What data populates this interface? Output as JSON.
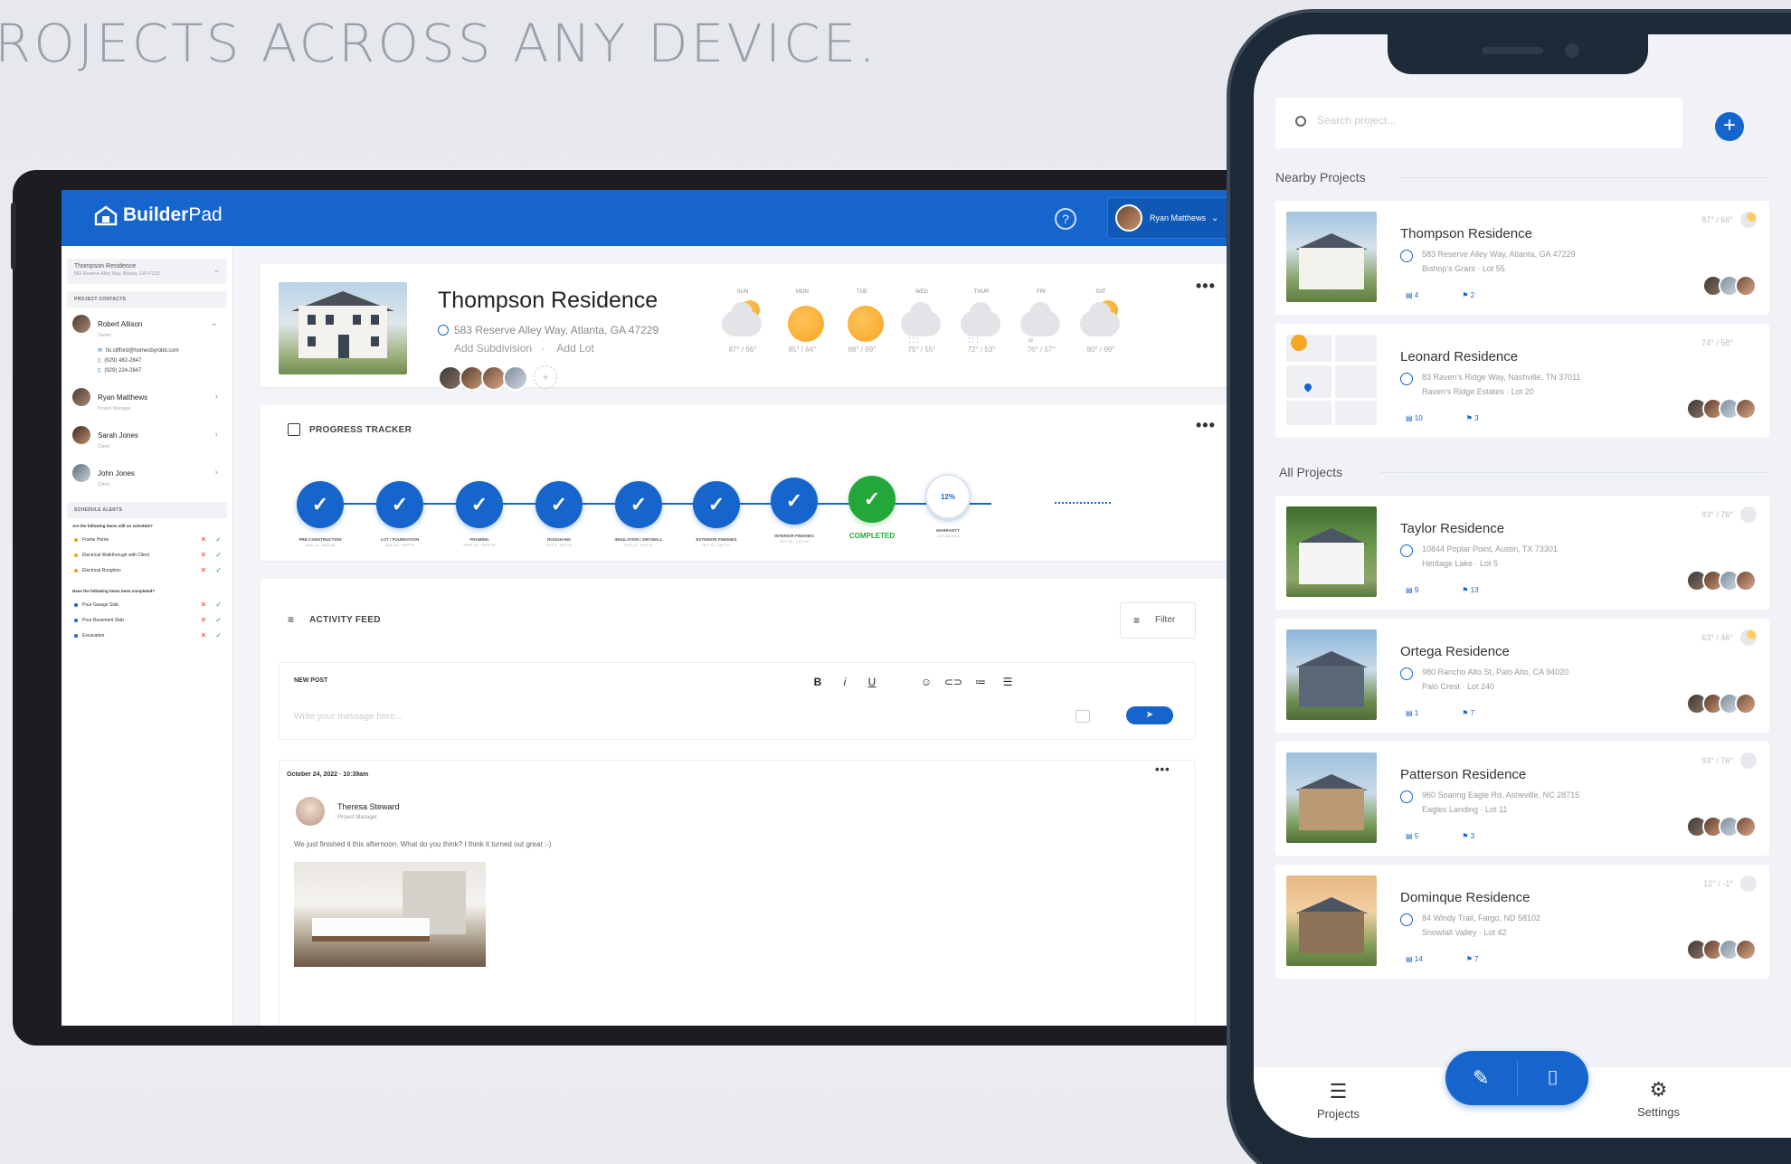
{
  "headline": "ROJECTS ACROSS ANY DEVICE.",
  "tablet": {
    "app": {
      "brand_bold": "Builder",
      "brand_light": "Pad",
      "help": "?",
      "user_name": "Ryan Matthews"
    },
    "sidebar": {
      "project_name": "Thompson Residence",
      "project_sub": "583 Reserve Alley Way, Atlanta, GA 47229",
      "contacts_header": "PROJECT CONTACTS",
      "contacts": [
        {
          "name": "Robert Allison",
          "role": "Owner"
        },
        {
          "name": "Ryan Matthews",
          "role": "Project Manager"
        },
        {
          "name": "Sarah Jones",
          "role": "Client"
        },
        {
          "name": "John Jones",
          "role": "Client"
        }
      ],
      "contact_details": [
        "fix.clifford@homesbyrobb.com",
        "(929) 482-2847",
        "(929) 224-2847"
      ],
      "alerts_header": "SCHEDULE ALERTS",
      "question1": "Are the following items still on schedule?",
      "alerts1": [
        "Frame Home",
        "Electrical Walkthrough with Client",
        "Electrical Roughins"
      ],
      "question2": "Have the following items been completed?",
      "alerts2": [
        "Pour Garage Slab",
        "Pour Basement Slab",
        "Excavation"
      ]
    },
    "project": {
      "title": "Thompson Residence",
      "address": "583 Reserve Alley Way,  Atlanta, GA 47229",
      "add_subdivision": "Add Subdivision",
      "add_lot": "Add Lot",
      "weather": [
        {
          "day": "SUN",
          "temp": "87° / 66°",
          "icon": "partly-cloudy"
        },
        {
          "day": "MON",
          "temp": "85° / 64°",
          "icon": "sunny"
        },
        {
          "day": "TUE",
          "temp": "88° / 69°",
          "icon": "sunny"
        },
        {
          "day": "WED",
          "temp": "75° / 55°",
          "icon": "rain"
        },
        {
          "day": "THUR",
          "temp": "72° / 53°",
          "icon": "rain"
        },
        {
          "day": "FRI",
          "temp": "76° / 57°",
          "icon": "windy-cloud"
        },
        {
          "day": "SAT",
          "temp": "80° / 69°",
          "icon": "partly-cloudy"
        }
      ]
    },
    "progress": {
      "title": "PROGRESS TRACKER",
      "steps": [
        {
          "label": "PRE-CONSTRUCTION",
          "dates": "AUG 12 - AUG 28"
        },
        {
          "label": "LOT / FOUNDATION",
          "dates": "AUG 30 - SEPT 8"
        },
        {
          "label": "FRAMING",
          "dates": "SEPT 10 - SEPT 20"
        },
        {
          "label": "ROUGH-INS",
          "dates": "OCT 3 - OCT 11"
        },
        {
          "label": "INSULATION / DRYWALL",
          "dates": "OCT 13 - OCT 17"
        },
        {
          "label": "EXTERIOR FINISHES",
          "dates": "OCT 13 - OCT 17"
        },
        {
          "label": "INTERIOR FINISHES",
          "dates": "OCT 25 - OCT 26"
        }
      ],
      "completed_label": "COMPLETED",
      "warranty_label": "WARRANTY",
      "warranty_date": "OCT 30 2023",
      "warranty_percent": "12%"
    },
    "feed": {
      "title": "ACTIVITY FEED",
      "filter": "Filter",
      "new_post": "NEW POST",
      "placeholder": "Write your message here...",
      "post": {
        "timestamp": "October 24, 2022  ·  10:39am",
        "author": "Theresa Steward",
        "role": "Project Manager",
        "message": "We just finished it this afternoon.  What do you think?  I think it turned out great :-)"
      }
    }
  },
  "phone": {
    "search_placeholder": "Search project...",
    "nearby_title": "Nearby Projects",
    "all_title": "All Projects",
    "nearby": [
      {
        "name": "Thompson Residence",
        "address": "583 Reserve Alley Way, Atlanta, GA 47229",
        "lot": "Bishop's Grant  ·  Lot 55",
        "comments": "4",
        "flags": "2",
        "temp": "87° / 66°",
        "weather": "partly-cloudy"
      },
      {
        "name": "Leonard Residence",
        "address": "83 Raven's Ridge Way, Nashville, TN 37011",
        "lot": "Raven's Ridge Estates  ·  Lot 20",
        "comments": "10",
        "flags": "3",
        "temp": "74° / 58°",
        "weather": "sunny"
      }
    ],
    "all": [
      {
        "name": "Taylor Residence",
        "address": "10844 Poplar Point, Austin, TX 73301",
        "lot": "Heritage Lake  ·  Lot 5",
        "comments": "9",
        "flags": "13",
        "temp": "93° / 76°",
        "weather": "cloudy"
      },
      {
        "name": "Ortega Residence",
        "address": "980 Rancho Alto St, Palo Alto, CA 94020",
        "lot": "Palo Crest  ·  Lot 240",
        "comments": "1",
        "flags": "7",
        "temp": "63° / 46°",
        "weather": "partly-cloudy"
      },
      {
        "name": "Patterson Residence",
        "address": "960 Soaring Eagle Rd, Asheville, NC 28715",
        "lot": "Eagles Landing  ·  Lot 11",
        "comments": "5",
        "flags": "3",
        "temp": "93° / 76°",
        "weather": "cloudy"
      },
      {
        "name": "Dominque Residence",
        "address": "84 Windy Trail, Fargo, ND 58102",
        "lot": "Snowfall Valley  ·  Lot 42",
        "comments": "14",
        "flags": "7",
        "temp": "12° / -1°",
        "weather": "cloudy"
      }
    ],
    "nav": {
      "projects": "Projects",
      "settings": "Settings"
    }
  }
}
